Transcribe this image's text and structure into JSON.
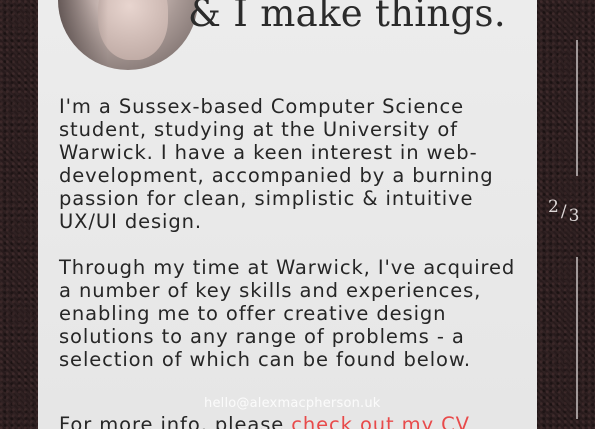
{
  "headline": "& I make things.",
  "bio": {
    "paragraphs": [
      "I'm a Sussex-based Computer Science student, studying at the University of Warwick. I have a keen interest in web-development, accompanied by a burning passion for clean, simplistic & intuitive UX/UI design.",
      "Through my time at Warwick, I've acquired a number of key skills and experiences, enabling me to offer creative design solutions to any range of problems - a selection of which can be found below."
    ],
    "more_prefix": "For more info, please ",
    "cv_link": "check out my CV"
  },
  "email": "hello@alexmacpherson.uk",
  "pager": {
    "current": "2",
    "separator": "/",
    "total": "3"
  },
  "colors": {
    "accent": "#e84a4a",
    "card": "#e8e8e8",
    "background": "#2a1c1d"
  }
}
